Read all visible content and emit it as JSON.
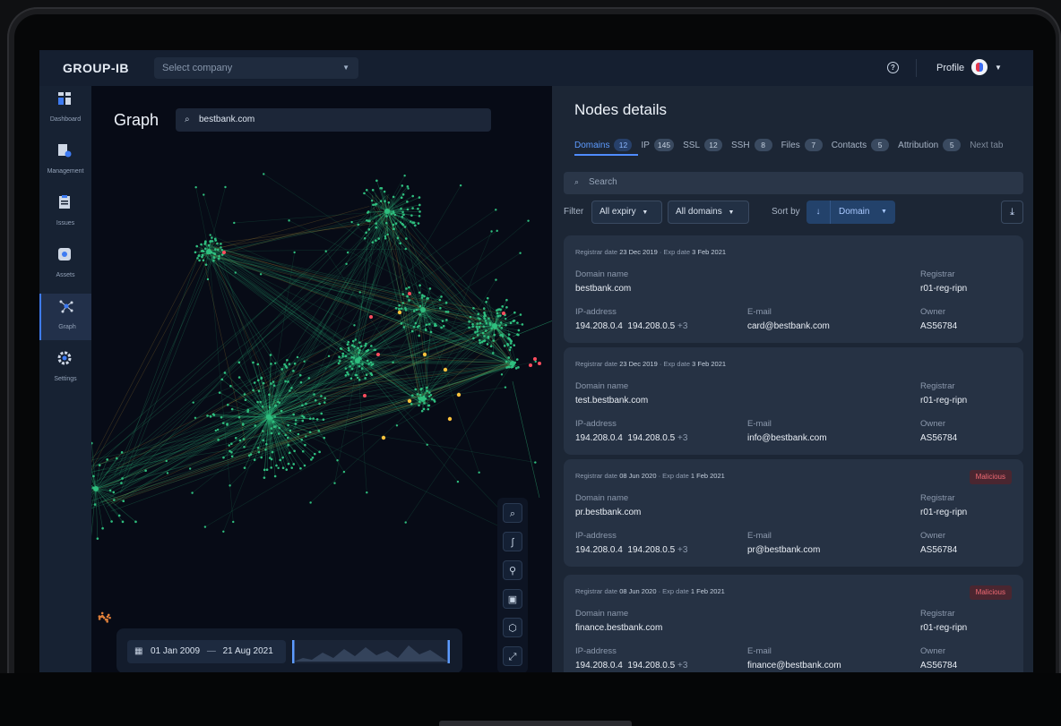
{
  "app": {
    "logo": "GROUP-IB"
  },
  "topbar": {
    "company_placeholder": "Select company",
    "profile_label": "Profile"
  },
  "sidebar": {
    "items": [
      {
        "label": "Dashboard",
        "icon": "dashboard-icon"
      },
      {
        "label": "Management",
        "icon": "management-icon"
      },
      {
        "label": "Issues",
        "icon": "issues-icon"
      },
      {
        "label": "Assets",
        "icon": "assets-icon"
      },
      {
        "label": "Graph",
        "icon": "graph-icon",
        "active": true
      },
      {
        "label": "Settings",
        "icon": "settings-icon"
      }
    ]
  },
  "graph": {
    "title": "Graph",
    "search_value": "bestbank.com",
    "date_from": "01 Jan 2009",
    "date_sep": "—",
    "date_to": "21 Aug 2021"
  },
  "details": {
    "title": "Nodes details",
    "tabs": [
      {
        "label": "Domains",
        "count": "12",
        "active": true
      },
      {
        "label": "IP",
        "count": "145"
      },
      {
        "label": "SSL",
        "count": "12"
      },
      {
        "label": "SSH",
        "count": "8"
      },
      {
        "label": "Files",
        "count": "7"
      },
      {
        "label": "Contacts",
        "count": "5"
      },
      {
        "label": "Attribution",
        "count": "5"
      },
      {
        "label": "Next tab",
        "count": ""
      }
    ],
    "search_placeholder": "Search",
    "filter_label": "Filter",
    "filter_expiry": "All expiry",
    "filter_domains": "All domains",
    "sort_label": "Sort by",
    "sort_value": "Domain",
    "labels": {
      "domain_name": "Domain name",
      "registrar": "Registrar",
      "ip": "IP-address",
      "email": "E-mail",
      "owner": "Owner",
      "reg_date": "Registrar date",
      "exp_date": "Exp date"
    },
    "cards": [
      {
        "reg": "23 Dec 2019",
        "exp": "3 Feb 2021",
        "badge": "",
        "domain": "bestbank.com",
        "registrar": "r01-reg-ripn",
        "ip": "194.208.0.4  194.208.0.5",
        "ip_more": "+3",
        "email": "card@bestbank.com",
        "owner": "AS56784"
      },
      {
        "reg": "23 Dec 2019",
        "exp": "3 Feb 2021",
        "badge": "",
        "domain": "test.bestbank.com",
        "registrar": "r01-reg-ripn",
        "ip": "194.208.0.4  194.208.0.5",
        "ip_more": "+3",
        "email": "info@bestbank.com",
        "owner": "AS56784"
      },
      {
        "reg": "08 Jun 2020",
        "exp": "1 Feb 2021",
        "badge": "Malicious",
        "domain": "pr.bestbank.com",
        "registrar": "r01-reg-ripn",
        "ip": "194.208.0.4  194.208.0.5",
        "ip_more": "+3",
        "email": "pr@bestbank.com",
        "owner": "AS56784"
      },
      {
        "reg": "08 Jun 2020",
        "exp": "1 Feb 2021",
        "badge": "Malicious",
        "domain": "finance.bestbank.com",
        "registrar": "r01-reg-ripn",
        "ip": "194.208.0.4  194.208.0.5",
        "ip_more": "+3",
        "email": "finance@bestbank.com",
        "owner": "AS56784"
      }
    ]
  },
  "colors": {
    "accent": "#4f8cff",
    "node": "#2fbf7f",
    "node_alert": "#ff4d5e",
    "node_warn": "#ffc23d"
  }
}
